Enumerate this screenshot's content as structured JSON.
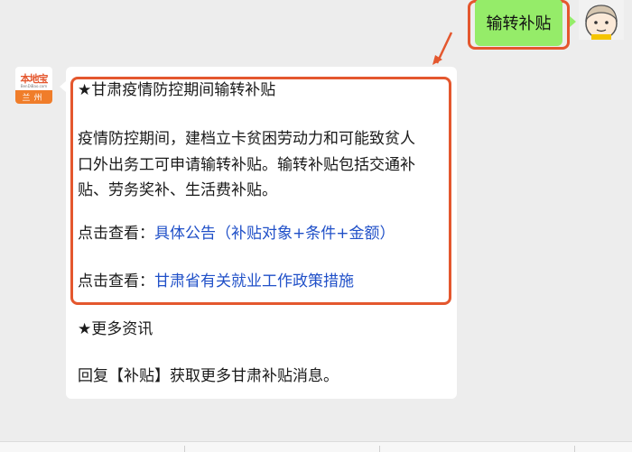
{
  "outgoing": {
    "text": "输转补贴"
  },
  "sender": {
    "logo_main": "本地宝",
    "logo_sub": "BenDiBao.com",
    "logo_city": "兰州"
  },
  "message": {
    "title": "★甘肃疫情防控期间输转补贴",
    "body_lines": [
      "疫情防控期间，建档立卡贫困劳动力和可能致贫人",
      "口外出务工可申请输转补贴。输转补贴包括交通补",
      "贴、劳务奖补、生活费补贴。"
    ],
    "link1": {
      "prefix": "点击查看：",
      "text": "具体公告（补贴对象+条件+金额）"
    },
    "link2": {
      "prefix": "点击查看：",
      "text": "甘肃省有关就业工作政策措施"
    },
    "more_title": "★更多资讯",
    "reply_text": "回复【补贴】获取更多甘肃补贴消息。"
  },
  "colors": {
    "highlight": "#e4572e",
    "outgoing_bubble": "#95ec69",
    "link": "#2050c8"
  },
  "icons": {
    "user_avatar": "cartoon-avatar-icon",
    "arrow": "red-arrow-icon"
  }
}
